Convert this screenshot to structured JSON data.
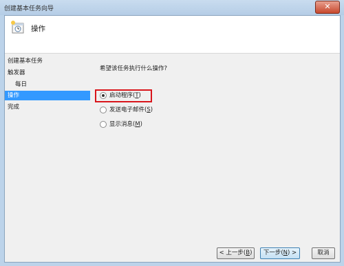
{
  "window": {
    "title": "创建基本任务向导",
    "close_label": "✕"
  },
  "header": {
    "title": "操作",
    "icon": "clock-task-icon"
  },
  "nav": {
    "items": [
      {
        "label": "创建基本任务",
        "level": 0,
        "active": false
      },
      {
        "label": "触发器",
        "level": 0,
        "active": false
      },
      {
        "label": "每日",
        "level": 1,
        "active": false
      },
      {
        "label": "操作",
        "level": 0,
        "active": true
      },
      {
        "label": "完成",
        "level": 0,
        "active": false
      }
    ]
  },
  "content": {
    "question": "希望该任务执行什么操作?",
    "options": [
      {
        "label": "启动程序(",
        "mnemonic": "T",
        "suffix": ")",
        "checked": true
      },
      {
        "label": "发送电子邮件(",
        "mnemonic": "S",
        "suffix": ")",
        "checked": false
      },
      {
        "label": "显示消息(",
        "mnemonic": "M",
        "suffix": ")",
        "checked": false
      }
    ]
  },
  "buttons": {
    "back": {
      "label": "< 上一步(",
      "mnemonic": "B",
      "suffix": ")"
    },
    "next": {
      "label": "下一步(",
      "mnemonic": "N",
      "suffix": ") >"
    },
    "cancel": {
      "label": "取消"
    }
  },
  "colors": {
    "highlight": "#d9141a",
    "selection": "#3399ff"
  }
}
